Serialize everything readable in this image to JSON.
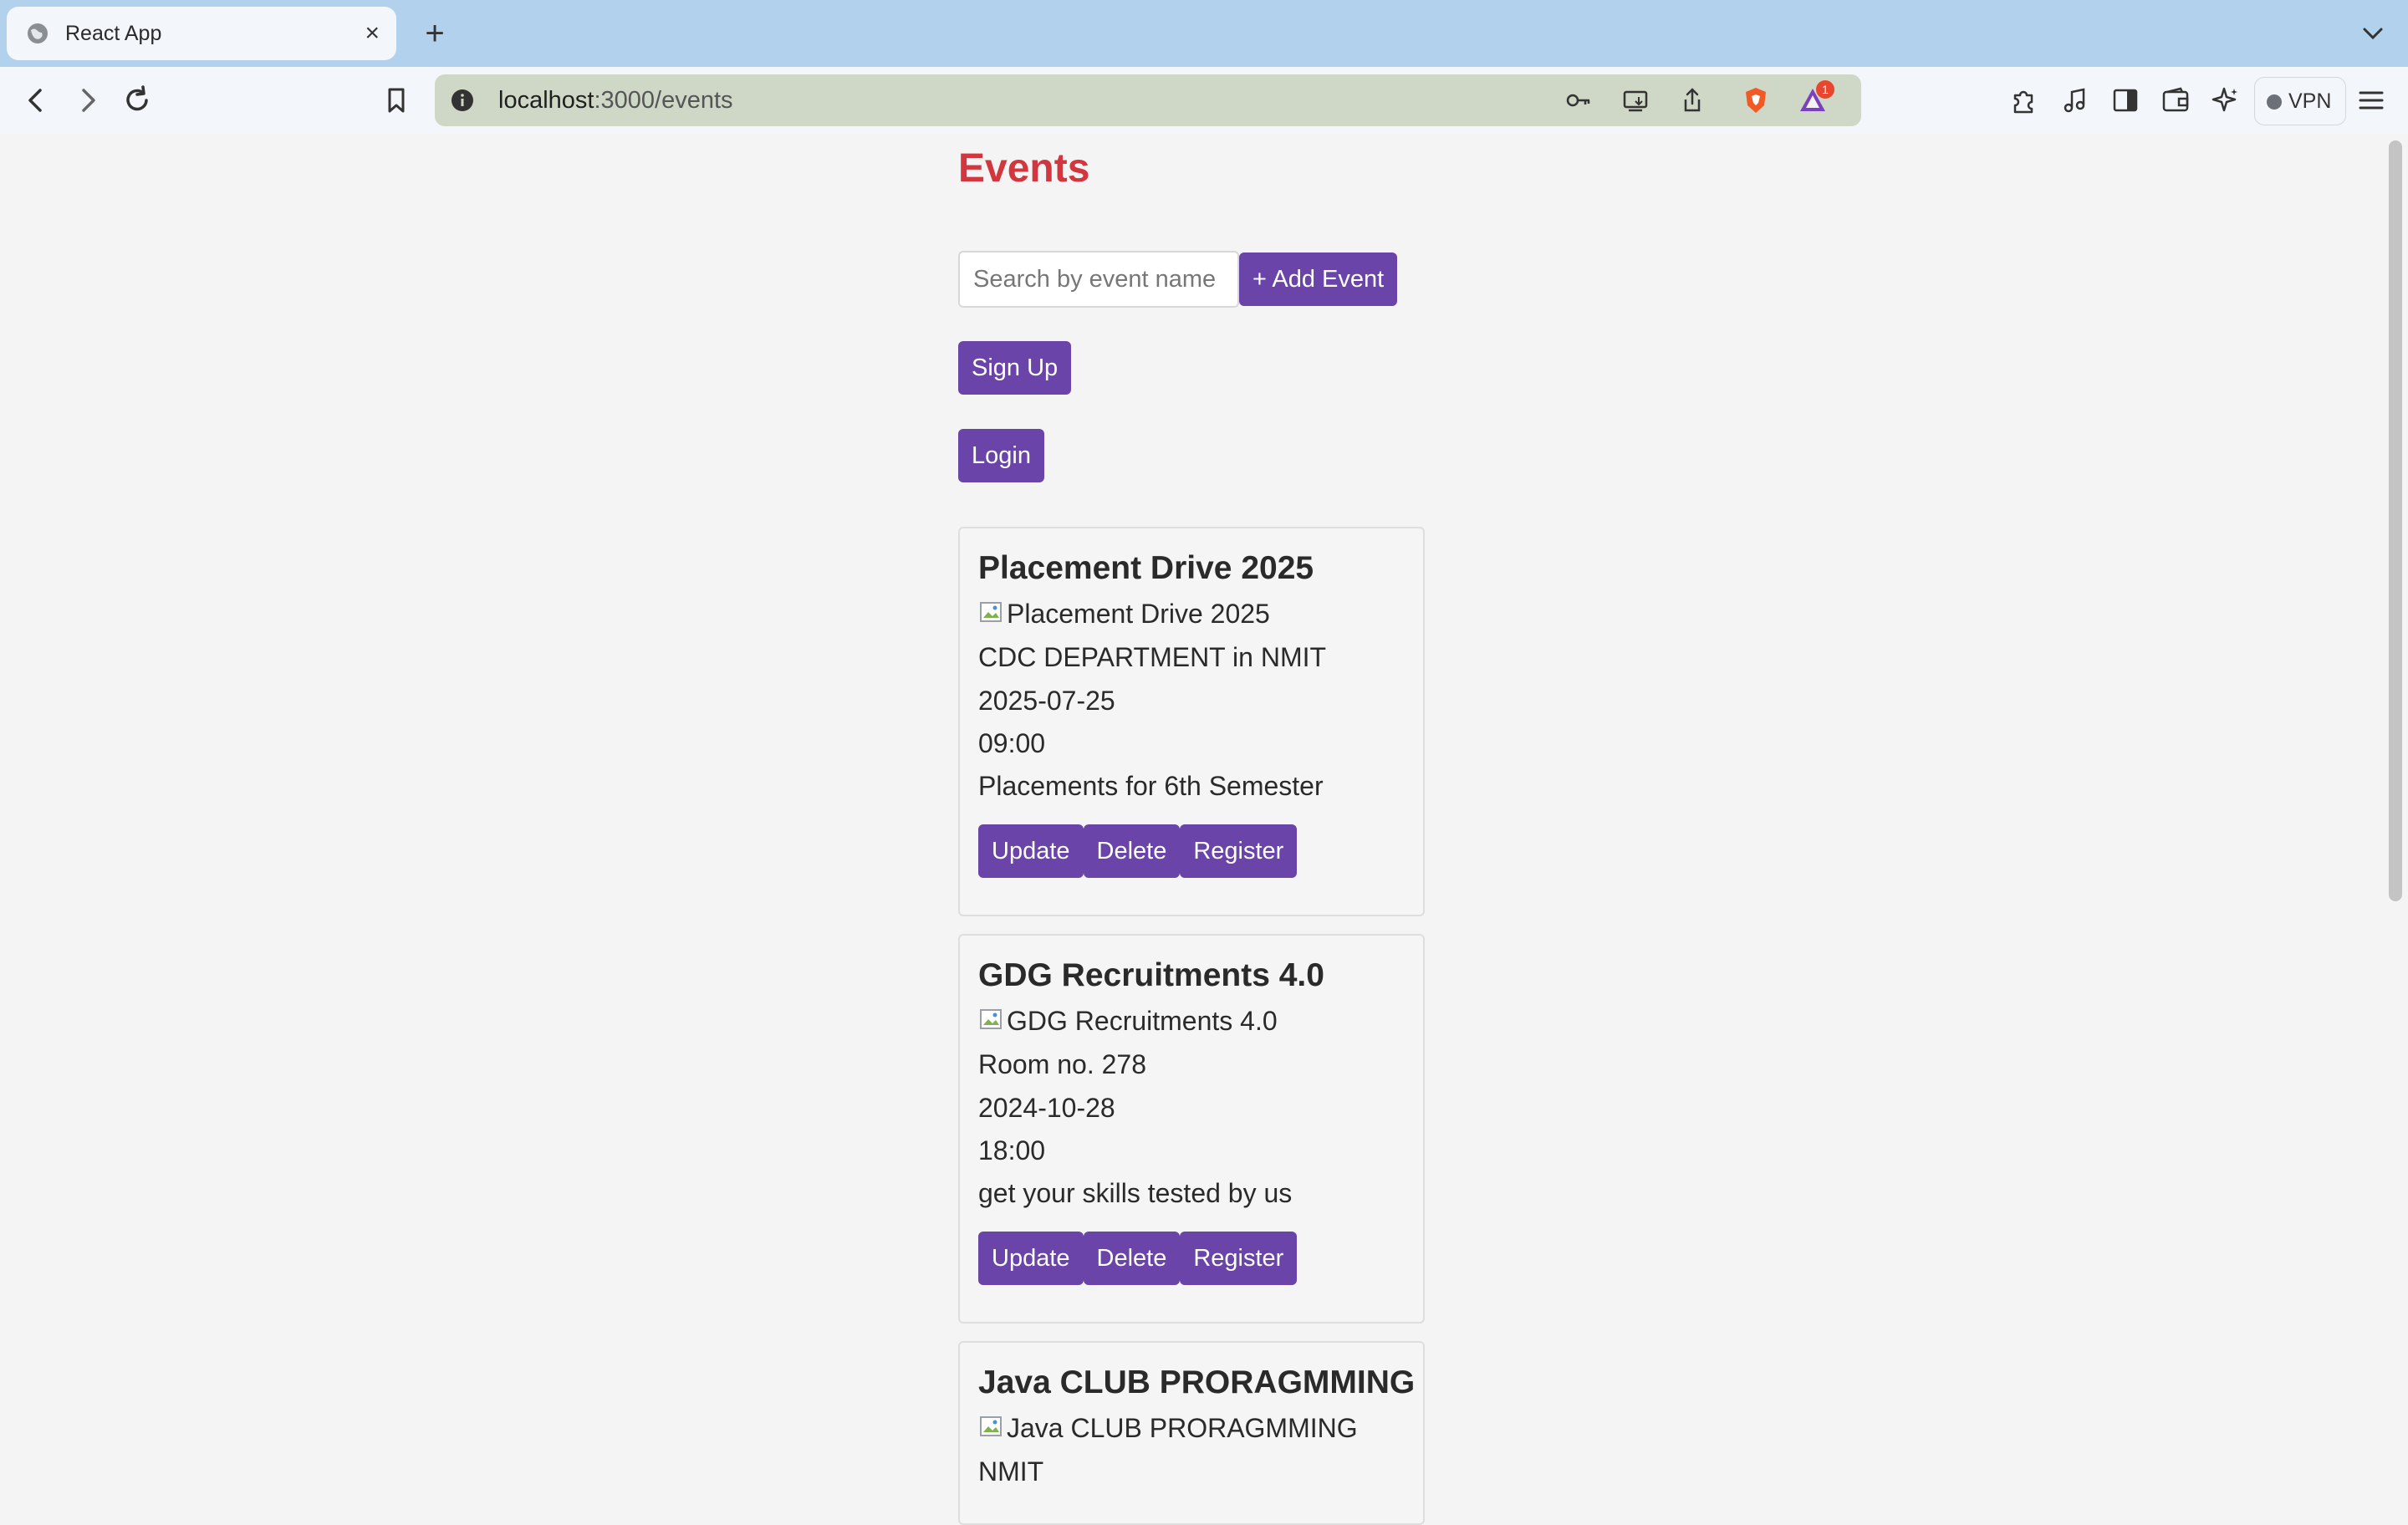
{
  "browser": {
    "tab": {
      "title": "React App",
      "close": "×"
    },
    "new_tab": "+",
    "url": {
      "host": "localhost",
      "path": ":3000/events"
    },
    "brave_badge": "1",
    "vpn_label": "VPN"
  },
  "page": {
    "title": "Events",
    "search": {
      "placeholder": "Search by event name",
      "value": ""
    },
    "add_event_label": "+ Add Event",
    "signup_label": "Sign Up",
    "login_label": "Login"
  },
  "events": [
    {
      "title": "Placement Drive 2025",
      "image_alt": "Placement Drive 2025",
      "location": "CDC DEPARTMENT in NMIT",
      "date": "2025-07-25",
      "time": "09:00",
      "description": "Placements for 6th Semester",
      "update_label": "Update",
      "delete_label": "Delete",
      "register_label": "Register"
    },
    {
      "title": "GDG Recruitments 4.0",
      "image_alt": "GDG Recruitments 4.0",
      "location": "Room no. 278",
      "date": "2024-10-28",
      "time": "18:00",
      "description": "get your skills tested by us",
      "update_label": "Update",
      "delete_label": "Delete",
      "register_label": "Register"
    },
    {
      "title": "Java CLUB PRORAGMMING",
      "image_alt": "Java CLUB PRORAGMMING",
      "location": "NMIT"
    }
  ],
  "colors": {
    "accent": "#6a44a8",
    "title": "#d2373f",
    "tabbar": "#b1d1ec",
    "urlbar": "#cfd8c6"
  },
  "icons": {
    "back": "back-arrow-icon",
    "forward": "forward-arrow-icon",
    "reload": "reload-icon",
    "bookmark": "bookmark-icon",
    "info": "info-icon",
    "key": "key-icon",
    "install": "install-app-icon",
    "share": "share-icon",
    "brave": "brave-shields-icon",
    "rewards": "brave-rewards-icon",
    "extensions": "extensions-icon",
    "media": "music-note-icon",
    "sidebar": "sidebar-icon",
    "wallet": "wallet-icon",
    "leo": "leo-ai-icon",
    "menu": "hamburger-menu-icon"
  }
}
